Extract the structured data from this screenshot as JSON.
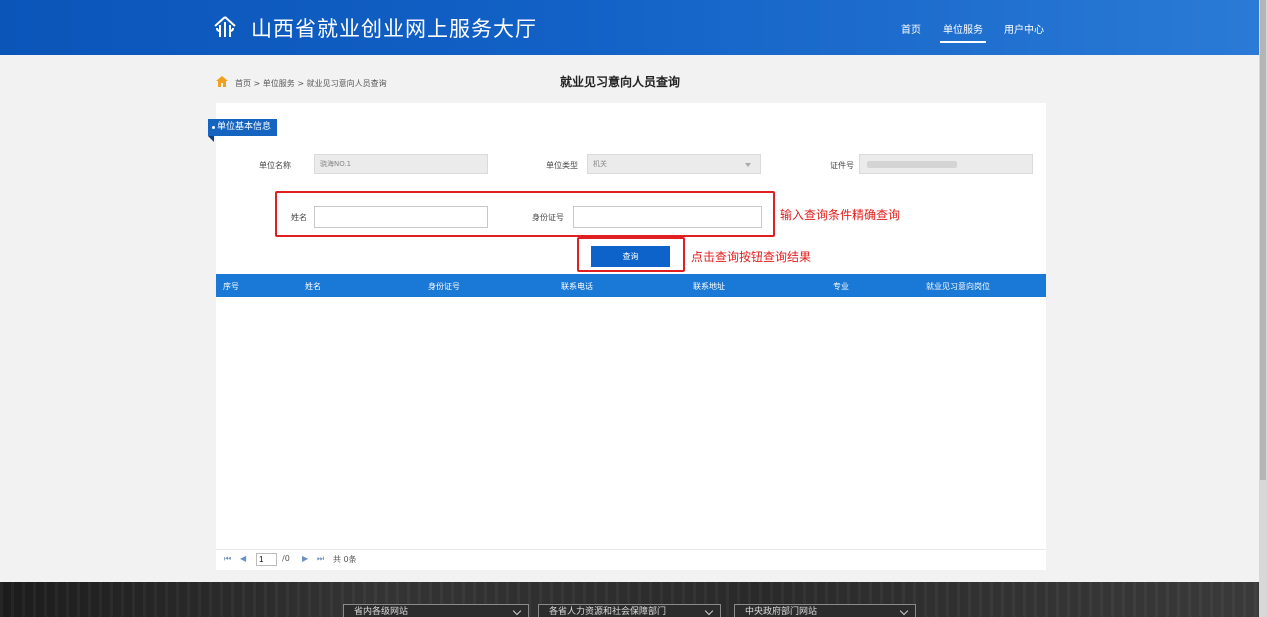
{
  "header": {
    "site_title": "山西省就业创业网上服务大厅",
    "nav": [
      "首页",
      "单位服务",
      "用户中心"
    ]
  },
  "breadcrumb": {
    "home": "首页",
    "sep": ">",
    "level1": "单位服务",
    "level2": "就业见习意向人员查询"
  },
  "page_title": "就业见习意向人员查询",
  "section": {
    "title": "单位基本信息"
  },
  "info": {
    "unit_name_label": "单位名称",
    "unit_name_value": "骁海NO.1",
    "unit_type_label": "单位类型",
    "unit_type_value": "机关",
    "cert_label": "证件号"
  },
  "query": {
    "name_label": "姓名",
    "name_value": "",
    "id_label": "身份证号",
    "id_value": "",
    "button": "查询"
  },
  "annotations": {
    "input_hint": "输入查询条件精确查询",
    "button_hint": "点击查询按钮查询结果"
  },
  "table": {
    "columns": [
      "序号",
      "姓名",
      "身份证号",
      "联系电话",
      "联系地址",
      "专业",
      "就业见习意向岗位"
    ],
    "rows": []
  },
  "pager": {
    "first": "⏮",
    "prev": "◀",
    "page_value": "1",
    "total_pages": "/0",
    "next": "▶",
    "last": "⏭",
    "total": "共 0条"
  },
  "footer": {
    "selects": [
      "省内各级网站",
      "各省人力资源和社会保障部门",
      "中央政府部门网站"
    ]
  },
  "colors": {
    "header_blue": "#0b55b9",
    "table_header_blue": "#1a78d6",
    "button_blue": "#0d63c9",
    "annotation_red": "#e02020",
    "home_icon_orange": "#f0a020"
  }
}
